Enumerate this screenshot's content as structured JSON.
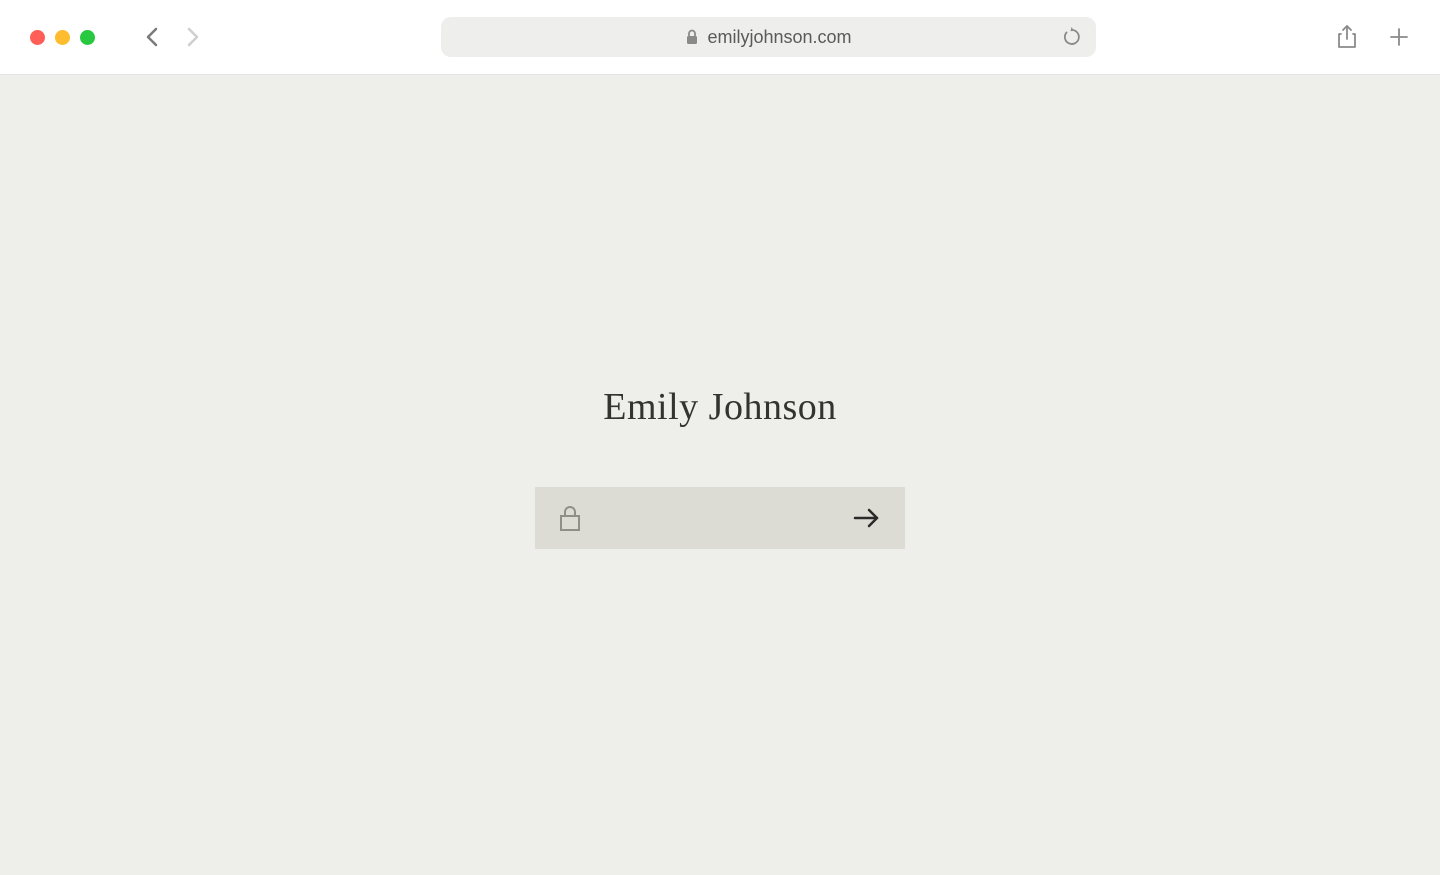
{
  "browser": {
    "url": "emilyjohnson.com"
  },
  "page": {
    "title": "Emily Johnson",
    "password_value": "",
    "password_placeholder": ""
  },
  "colors": {
    "page_bg": "#eeeeea",
    "input_bg": "#dcdcd5",
    "text": "#333330"
  }
}
